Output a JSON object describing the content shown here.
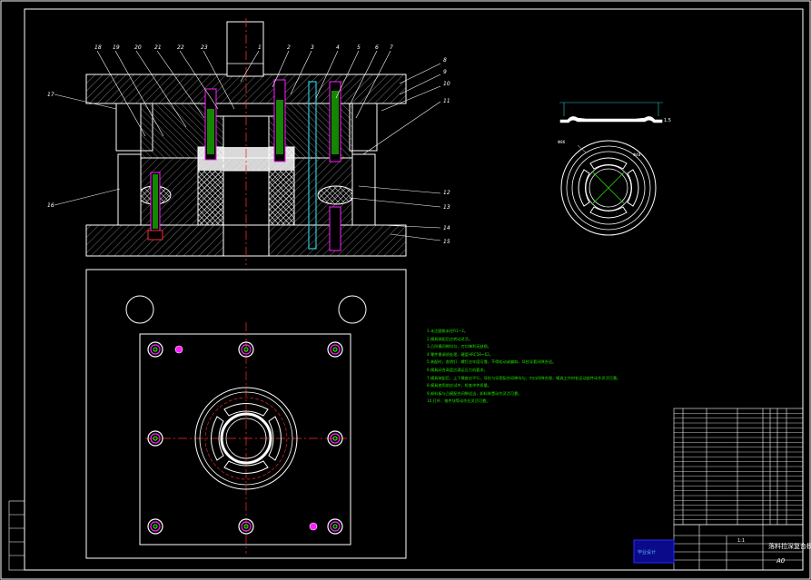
{
  "drawing": {
    "part_numbers_top": [
      "18",
      "19",
      "20",
      "21",
      "22",
      "23",
      "1",
      "2",
      "3",
      "4",
      "5",
      "6",
      "7"
    ],
    "part_numbers_right": [
      "8",
      "9",
      "10",
      "11",
      "12",
      "13",
      "14",
      "15"
    ],
    "part_numbers_left": [
      "17",
      "16"
    ],
    "dimension_labels": {
      "thickness": "1.5",
      "outer_dia": "Φ86",
      "inner_dia": "Φ48"
    },
    "notes": [
      "1.未注圆角半径R1~2。",
      "2.模具装配后应转动灵活。",
      "3.凸凹模间隙均匀，刃口锋利无缺损。",
      "4.零件需调质处理，硬度HRC58~62。",
      "5.装配时，各销钉、螺钉应牢固可靠，不得松动或偏斜，导柱导套间隙合适。",
      "6.模具闭合高度应满足压力机要求。",
      "7.模具装配后，上下模座应平行，导柱与导套配合间隙均匀，刃口间隙合理，模具工作时各运动部件动作灵活可靠。",
      "8.模具使用前应试冲，检查冲件质量。",
      "9.卸料板与凸模配合间隙适当，卸料装置动作灵活可靠。",
      "10.打杆、推件块等动作应灵活可靠。"
    ],
    "title_block": {
      "title": "落料拉深复合模",
      "scale": "1:1",
      "sheet": "A0",
      "school_stamp": "毕业设计"
    }
  },
  "colors": {
    "line": "#ffffff",
    "hatch": "#ffffff",
    "center": "#ff2a2a",
    "green": "#22e000",
    "magenta": "#ff20ff",
    "cyan": "#29c9d9",
    "blue": "#2a2aff"
  }
}
